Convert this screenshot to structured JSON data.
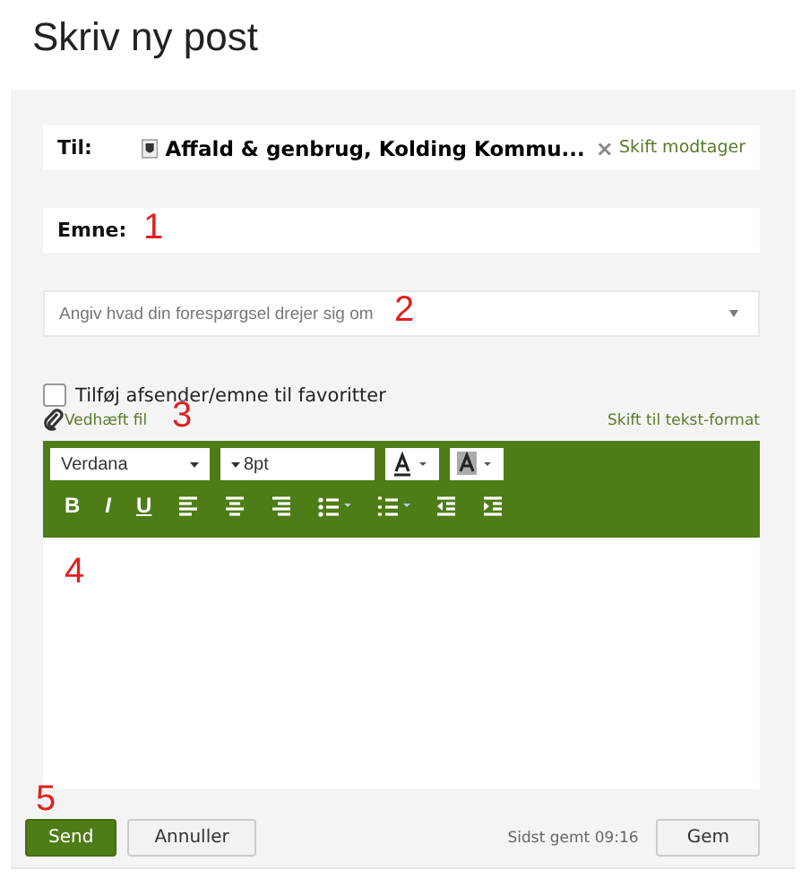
{
  "page_title": "Skriv ny post",
  "to": {
    "label": "Til:",
    "recipient": "Affald & genbrug, Kolding Kommu...",
    "remove": "×",
    "change_link": "Skift modtager"
  },
  "subject": {
    "label": "Emne:",
    "annotation": "1"
  },
  "topic": {
    "placeholder": "Angiv hvad din forespørgsel drejer sig om",
    "annotation": "2"
  },
  "favorite": {
    "label": "Tilføj afsender/emne til favoritter",
    "checked": false
  },
  "attach": {
    "label": "Vedhæft fil",
    "annotation": "3"
  },
  "switch_format": "Skift til tekst-format",
  "toolbar": {
    "font": "Verdana",
    "size": "8pt",
    "buttons": [
      {
        "kind": "bold",
        "label": "B"
      },
      {
        "kind": "italic",
        "label": "I"
      },
      {
        "kind": "underline",
        "label": "U"
      },
      {
        "kind": "align-left"
      },
      {
        "kind": "align-center"
      },
      {
        "kind": "align-right"
      },
      {
        "kind": "bullets"
      },
      {
        "kind": "numbers"
      },
      {
        "kind": "outdent"
      },
      {
        "kind": "indent"
      }
    ]
  },
  "editor": {
    "annotation": "4"
  },
  "footer": {
    "annotation": "5",
    "send": "Send",
    "cancel": "Annuller",
    "saved": "Sidst gemt 09:16",
    "save": "Gem"
  }
}
